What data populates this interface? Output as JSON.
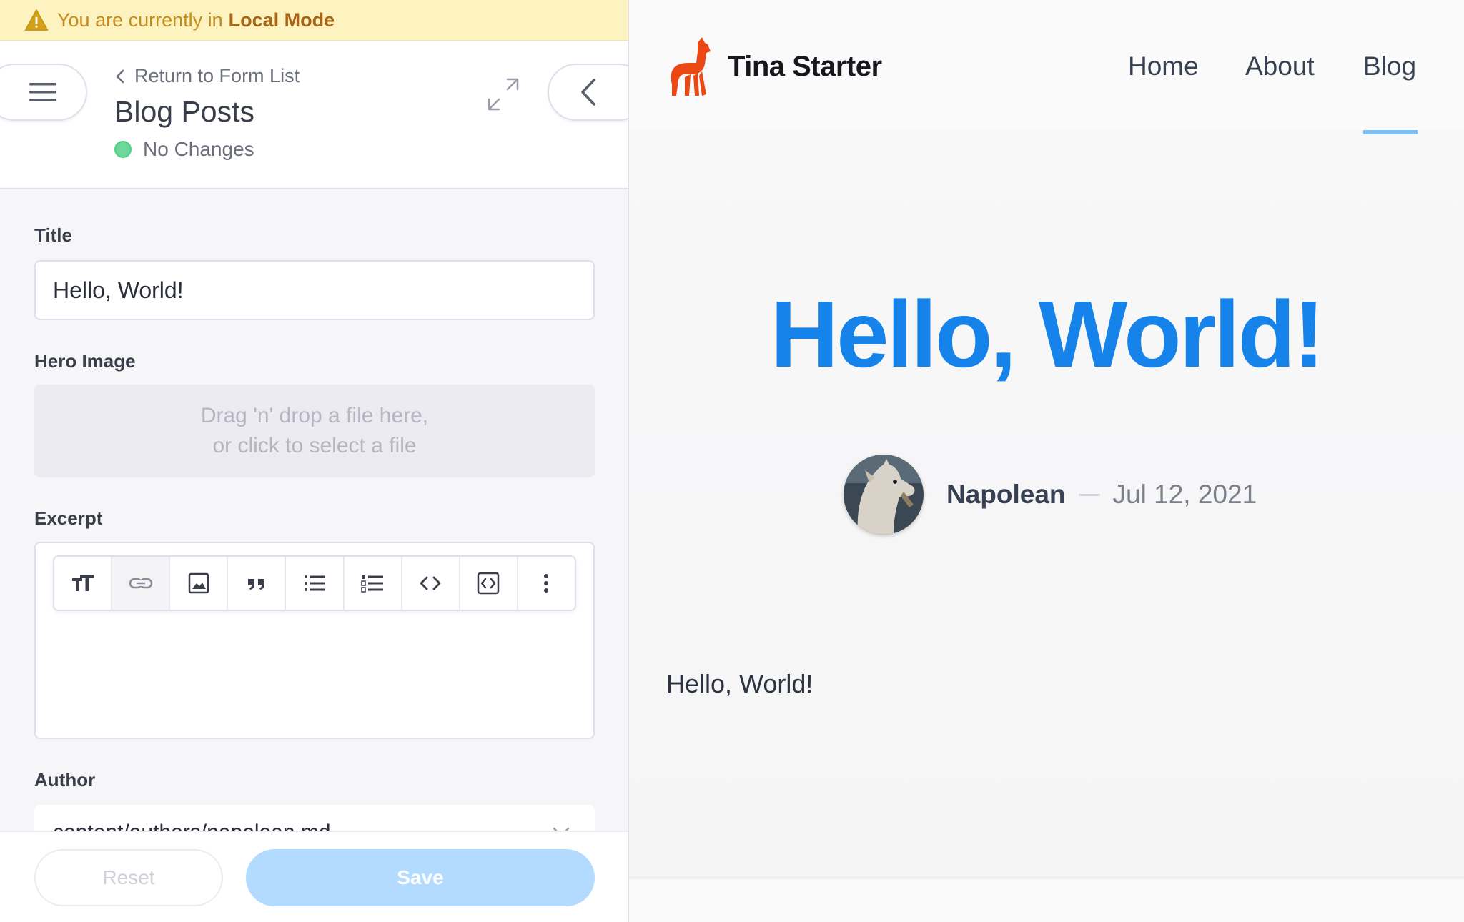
{
  "banner": {
    "text": "You are currently in",
    "mode": "Local Mode"
  },
  "header": {
    "return_label": "Return to Form List",
    "form_title": "Blog Posts",
    "status": "No Changes"
  },
  "fields": {
    "title": {
      "label": "Title",
      "value": "Hello, World!"
    },
    "hero_image": {
      "label": "Hero Image",
      "line1": "Drag 'n' drop a file here,",
      "line2": "or click to select a file"
    },
    "excerpt": {
      "label": "Excerpt"
    },
    "author": {
      "label": "Author",
      "value": "content/authors/napolean.md"
    }
  },
  "footer": {
    "reset_label": "Reset",
    "save_label": "Save"
  },
  "site": {
    "name": "Tina Starter",
    "nav": [
      "Home",
      "About",
      "Blog"
    ],
    "active_nav": "Blog",
    "post": {
      "title": "Hello, World!",
      "author": "Napolean",
      "date": "Jul 12, 2021",
      "body": "Hello, World!"
    }
  },
  "colors": {
    "banner_bg": "#fcf3c0",
    "status_green": "#6ed79a",
    "save_bg": "#b2dbff",
    "hero_blue": "#1683ea",
    "logo_orange": "#ec4815"
  }
}
